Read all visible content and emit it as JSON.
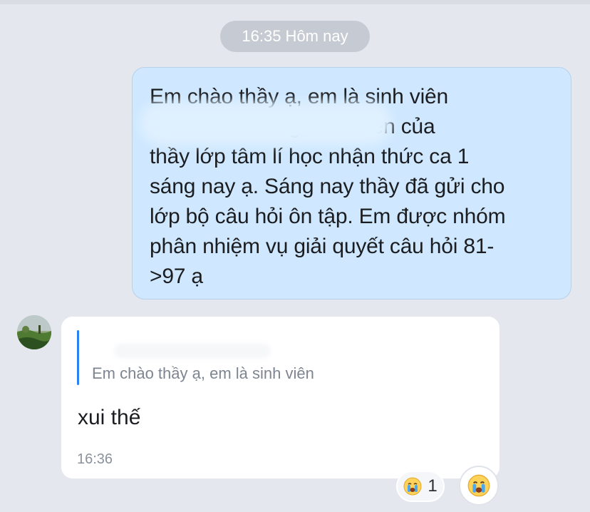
{
  "chat": {
    "timestamp_header": "16:35 Hôm nay",
    "sent_message": {
      "text": "Em chào thầy ạ, em là sinh viên\n                        g, sinh viên của\nthầy lớp tâm lí học nhận thức ca 1\nsáng nay ạ. Sáng nay thầy đã gửi cho\nlớp bộ câu hỏi ôn tập. Em được nhóm\nphân nhiệm vụ giải quyết câu hỏi 81-\n>97 ạ"
    },
    "received_message": {
      "quote_text": "Em chào thầy ạ, em là sinh viên",
      "text": "xui thế",
      "time": "16:36"
    },
    "reaction": {
      "emoji_icon": "crying-face-icon",
      "count": "1"
    },
    "colors": {
      "background": "#e4e8ee",
      "sent_bubble": "#cfe8ff",
      "received_bubble": "#ffffff",
      "quote_accent": "#2a82f2"
    }
  }
}
